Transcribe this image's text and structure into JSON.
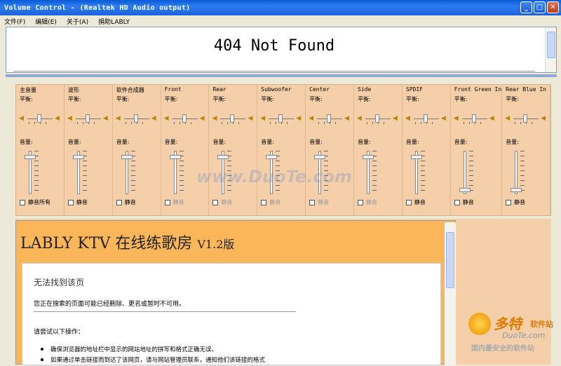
{
  "window": {
    "title": "Volume Control - (Realtek HD Audio output)"
  },
  "menu": [
    "文件(F)",
    "编辑(E)",
    "关于(A)",
    "捐助LABLY"
  ],
  "display": {
    "message": "404 Not Found"
  },
  "mixer": {
    "balance_label": "平衡:",
    "volume_label": "音量:",
    "channels": [
      {
        "name": "主音量",
        "mute": "静音所有",
        "enabled": true,
        "level": 0.1
      },
      {
        "name": "波形",
        "mute": "静音",
        "enabled": true,
        "level": 0.1
      },
      {
        "name": "软件合成器",
        "mute": "静音",
        "enabled": true,
        "level": 0.1
      },
      {
        "name": "Front",
        "mute": "静音",
        "enabled": false,
        "level": 0.1
      },
      {
        "name": "Rear",
        "mute": "静音",
        "enabled": false,
        "level": 0.1
      },
      {
        "name": "Subwoofer",
        "mute": "静音",
        "enabled": false,
        "level": 0.1
      },
      {
        "name": "Center",
        "mute": "静音",
        "enabled": false,
        "level": 0.1
      },
      {
        "name": "Side",
        "mute": "静音",
        "enabled": false,
        "level": 0.1
      },
      {
        "name": "SPDIF",
        "mute": "静音",
        "enabled": true,
        "level": 0.1
      },
      {
        "name": "Front Green In",
        "mute": "静音",
        "enabled": true,
        "level": 0.95
      },
      {
        "name": "Rear Blue In",
        "mute": "静音",
        "enabled": true,
        "level": 0.95
      }
    ]
  },
  "banner": {
    "title": "LABLY KTV 在线练歌房",
    "version": "V1.2版"
  },
  "error_page": {
    "heading": "无法找到该页",
    "desc": "您正在搜索的页面可能已经删除、更名或暂时不可用。",
    "try": "请尝试以下操作：",
    "items": [
      "确保浏览器的地址栏中显示的网站地址的拼写和格式正确无误。",
      "如果通过单击链接而到达了该网页，请与网站管理员联系，通知他们该链接的格式"
    ]
  },
  "watermark": "www.DuoTe.com",
  "logo": {
    "big": "多特",
    "small": "软件站",
    "domain": "DuoTe.com",
    "slogan": "国内最安全的软件站"
  }
}
